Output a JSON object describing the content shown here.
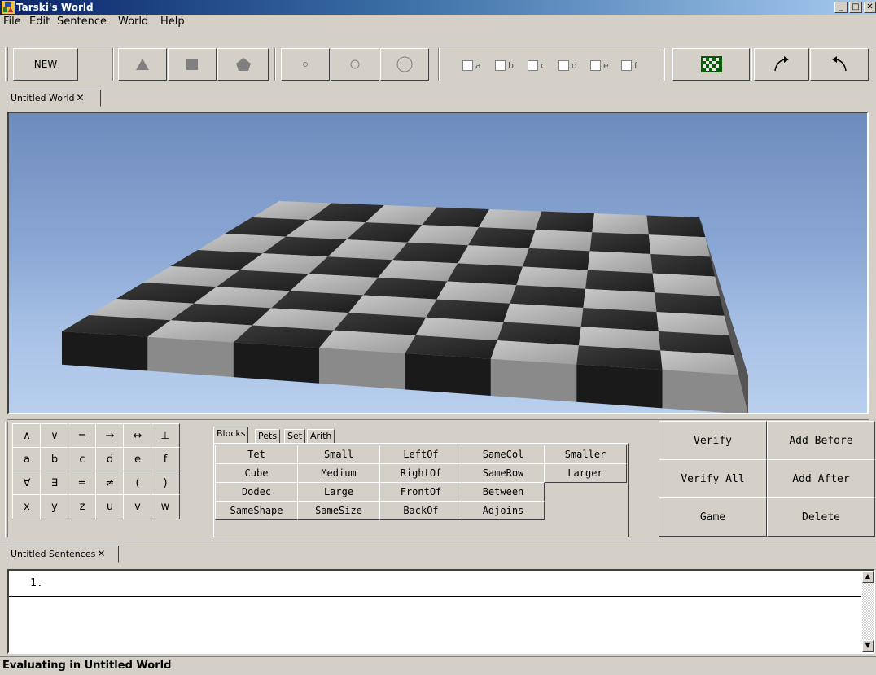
{
  "window": {
    "title": "Tarski's World"
  },
  "menu": [
    "File",
    "Edit",
    "Sentence",
    "World",
    "Help"
  ],
  "toolbar": {
    "new_label": "NEW",
    "name_checkboxes": [
      "a",
      "b",
      "c",
      "d",
      "e",
      "f"
    ],
    "icons": [
      "triangle-icon",
      "square-icon",
      "pentagon-icon",
      "small-circle-icon",
      "medium-circle-icon",
      "large-circle-icon",
      "checkerboard-icon",
      "redo-arrow-icon",
      "undo-arrow-icon"
    ]
  },
  "world_tab": {
    "label": "Untitled World",
    "close": "✕"
  },
  "symbols": [
    [
      "∧",
      "∨",
      "¬",
      "→",
      "↔",
      "⊥"
    ],
    [
      "a",
      "b",
      "c",
      "d",
      "e",
      "f"
    ],
    [
      "∀",
      "∃",
      "=",
      "≠",
      "(",
      ")"
    ],
    [
      "x",
      "y",
      "z",
      "u",
      "v",
      "w"
    ]
  ],
  "predicate_tabs": [
    "Blocks",
    "Pets",
    "Set",
    "Arith"
  ],
  "predicates": [
    [
      "Tet",
      "Small",
      "LeftOf",
      "SameCol",
      "Smaller"
    ],
    [
      "Cube",
      "Medium",
      "RightOf",
      "SameRow",
      "Larger"
    ],
    [
      "Dodec",
      "Large",
      "FrontOf",
      "Between",
      ""
    ],
    [
      "SameShape",
      "SameSize",
      "BackOf",
      "Adjoins",
      ""
    ]
  ],
  "actions": {
    "verify": "Verify",
    "add_before": "Add Before",
    "verify_all": "Verify All",
    "add_after": "Add After",
    "game": "Game",
    "delete": "Delete"
  },
  "sentences_tab": {
    "label": "Untitled Sentences",
    "close": "✕"
  },
  "sentences": [
    {
      "number": "1.",
      "text": ""
    }
  ],
  "status": "Evaluating in Untitled World"
}
